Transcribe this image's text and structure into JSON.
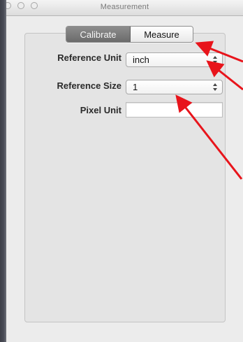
{
  "window": {
    "title": "Measurement"
  },
  "segmented": {
    "calibrate_label": "Calibrate",
    "measure_label": "Measure",
    "selected": "Calibrate"
  },
  "form": {
    "reference_unit": {
      "label": "Reference Unit",
      "value": "inch"
    },
    "reference_size": {
      "label": "Reference Size",
      "value": "1"
    },
    "pixel_unit": {
      "label": "Pixel Unit",
      "value": ""
    }
  },
  "colors": {
    "annotation_arrow": "#e8141b",
    "segment_active": "#777777",
    "window_background": "#ececec"
  },
  "icons": [
    "popup-arrows-icon",
    "window-close-icon",
    "window-minimize-icon",
    "window-zoom-icon"
  ]
}
